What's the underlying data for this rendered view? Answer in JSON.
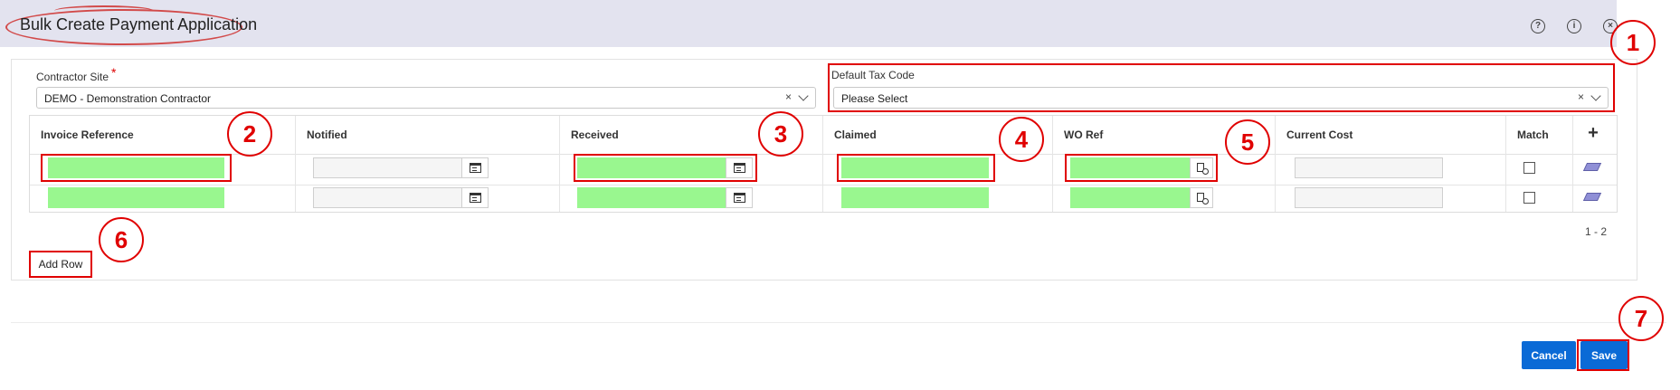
{
  "header": {
    "title": "Bulk Create Payment Application",
    "icons": [
      "help-icon",
      "info-icon",
      "close-icon"
    ]
  },
  "form": {
    "contractor_site": {
      "label": "Contractor Site",
      "required_mark": "*",
      "value": "DEMO - Demonstration Contractor",
      "clear": "×"
    },
    "default_tax_code": {
      "label": "Default Tax Code",
      "value": "Please Select",
      "clear": "×"
    }
  },
  "grid": {
    "columns": [
      "Invoice Reference",
      "Notified",
      "Received",
      "Claimed",
      "WO Ref",
      "Current Cost",
      "Match"
    ],
    "add_column_symbol": "+",
    "rows": [
      {
        "invoice_reference": "",
        "notified": "",
        "received": "",
        "claimed": "",
        "wo_ref": "",
        "current_cost": "",
        "match": false
      },
      {
        "invoice_reference": "",
        "notified": "",
        "received": "",
        "claimed": "",
        "wo_ref": "",
        "current_cost": "",
        "match": false
      }
    ],
    "pagination": "1 - 2"
  },
  "actions": {
    "add_row_label": "Add Row",
    "cancel_label": "Cancel",
    "save_label": "Save"
  },
  "annotations": {
    "badges": [
      "1",
      "2",
      "3",
      "4",
      "5",
      "6",
      "7"
    ],
    "color": "#e00000"
  },
  "colors": {
    "accent": "#0a6ad6",
    "highlight_field": "#99f78f",
    "titlebar": "#e3e3ef"
  }
}
